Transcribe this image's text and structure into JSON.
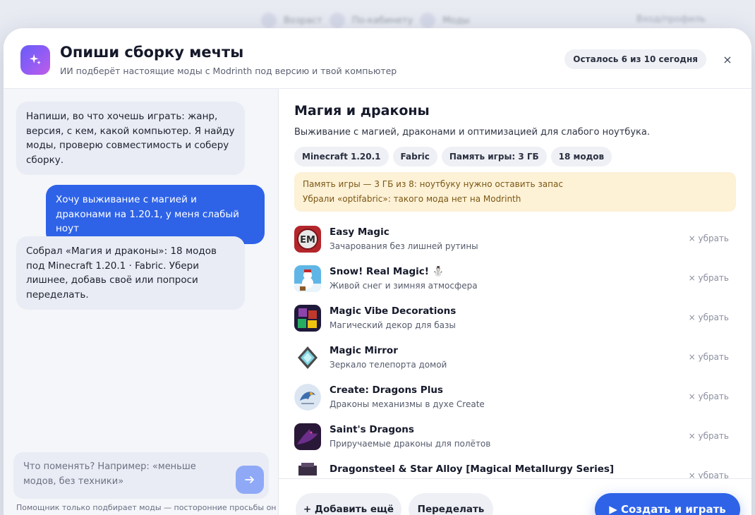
{
  "background": {
    "steps": [
      "Возраст",
      "По-кабинету",
      "Моды"
    ],
    "right_label": "Вход/профиль"
  },
  "header": {
    "title": "Опиши сборку мечты",
    "subtitle": "ИИ подберёт настоящие моды с Modrinth под версию и твой компьютер",
    "quota": "Осталось 6 из 10 сегодня",
    "close_label": "×",
    "logo_icon": "sparkles-icon"
  },
  "chat": {
    "messages": [
      {
        "role": "ai",
        "text": "Напиши, во что хочешь играть: жанр, версия, с кем, какой компьютер. Я найду моды, проверю совместимость и соберу сборку."
      },
      {
        "role": "user",
        "text": "Хочу выживание с магией и драконами на 1.20.1, у меня слабый ноут"
      },
      {
        "role": "ai",
        "text": "Собрал «Магия и драконы»: 18 модов под Minecraft 1.20.1 · Fabric. Убери лишнее, добавь своё или попроси переделать."
      }
    ],
    "input_placeholder": "Что поменять? Например: «меньше модов, без техники»",
    "send_icon": "arrow-right-icon",
    "disclaimer": "Помощник только подбирает моды — посторонние просьбы он"
  },
  "pack": {
    "title": "Магия и драконы",
    "description": "Выживание с магией, драконами и оптимизацией для слабого ноутбука.",
    "tags": [
      "Minecraft 1.20.1",
      "Fabric",
      "Память игры: 3 ГБ",
      "18 модов"
    ],
    "notices": [
      "Память игры — 3 ГБ из 8: ноутбуку нужно оставить запас",
      "Убрали «optifabric»: такого мода нет на Modrinth"
    ],
    "remove_label": "× убрать",
    "mods": [
      {
        "name": "Easy Magic",
        "desc": "Зачарования без лишней рутины",
        "icon": "easy-magic-icon"
      },
      {
        "name": "Snow! Real Magic! ⛄",
        "desc": "Живой снег и зимняя атмосфера",
        "icon": "snowman-icon"
      },
      {
        "name": "Magic Vibe Decorations",
        "desc": "Магический декор для базы",
        "icon": "decor-blocks-icon"
      },
      {
        "name": "Magic Mirror",
        "desc": "Зеркало телепорта домой",
        "icon": "mirror-icon"
      },
      {
        "name": "Create: Dragons Plus",
        "desc": "Драконы механизмы в духе Create",
        "icon": "dragon-mech-icon"
      },
      {
        "name": "Saint's Dragons",
        "desc": "Приручаемые драконы для полётов",
        "icon": "dragon-icon"
      },
      {
        "name": "Dragonsteel & Star Alloy [Magical Metallurgy Series]",
        "desc": "",
        "icon": "dragonsteel-icon"
      }
    ]
  },
  "footer": {
    "add_label": "+ Добавить ещё",
    "redo_label": "Переделать",
    "create_label": "▶ Создать и играть"
  }
}
